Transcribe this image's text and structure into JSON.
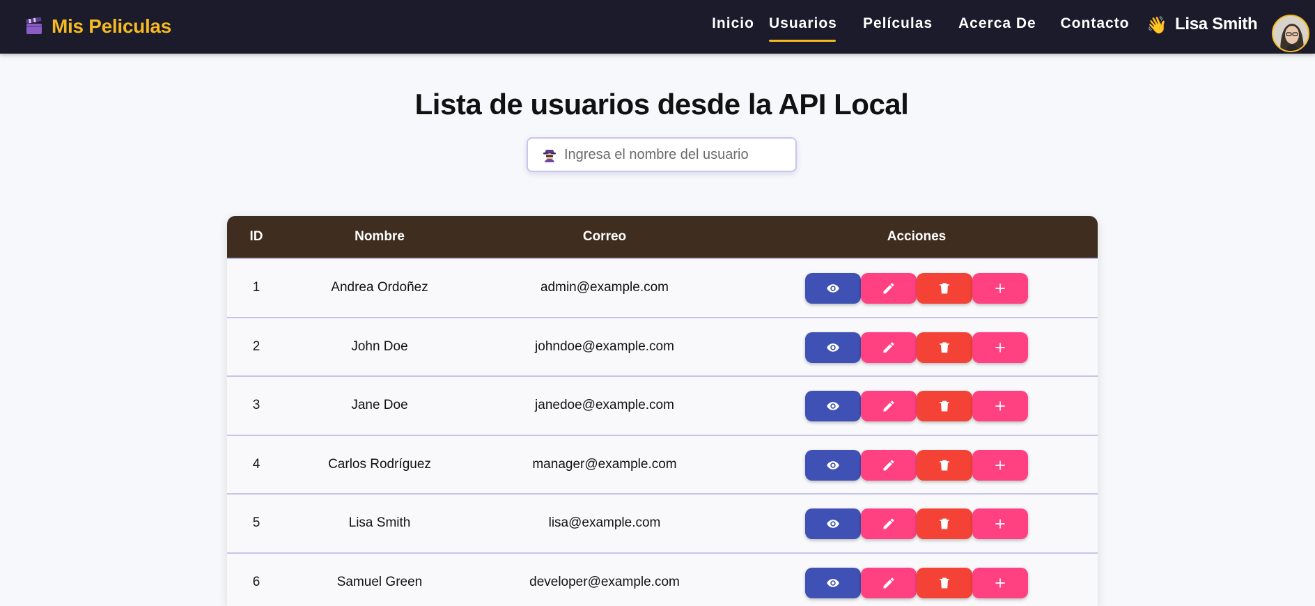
{
  "brand": {
    "title": "Mis Peliculas",
    "color": "#f5b921",
    "icon": "clapperboard-icon"
  },
  "nav": {
    "items": [
      {
        "label": "Inicio"
      },
      {
        "label": "Usuarios",
        "active": true
      },
      {
        "label": "Películas"
      },
      {
        "label": "Acerca De"
      },
      {
        "label": "Contacto"
      }
    ],
    "greeting_icon": "👋",
    "user_name": "Lisa Smith"
  },
  "page": {
    "title": "Lista de usuarios desde la API Local"
  },
  "search": {
    "placeholder": "Ingresa el nombre del usuario",
    "value": "",
    "icon": "detective-icon"
  },
  "table": {
    "headers": {
      "id": "ID",
      "name": "Nombre",
      "email": "Correo",
      "actions": "Acciones"
    },
    "rows": [
      {
        "id": "1",
        "name": "Andrea Ordoñez",
        "email": "admin@example.com"
      },
      {
        "id": "2",
        "name": "John Doe",
        "email": "johndoe@example.com"
      },
      {
        "id": "3",
        "name": "Jane Doe",
        "email": "janedoe@example.com"
      },
      {
        "id": "4",
        "name": "Carlos Rodríguez",
        "email": "manager@example.com"
      },
      {
        "id": "5",
        "name": "Lisa Smith",
        "email": "lisa@example.com"
      },
      {
        "id": "6",
        "name": "Samuel Green",
        "email": "developer@example.com"
      }
    ],
    "action_buttons": [
      {
        "icon": "eye-icon",
        "color": "#3f51b5"
      },
      {
        "icon": "pencil-icon",
        "color": "#ff4081"
      },
      {
        "icon": "trash-icon",
        "color": "#f44336"
      },
      {
        "icon": "plus-icon",
        "color": "#ff4081"
      }
    ]
  },
  "colors": {
    "navbar": "#1c1b2c",
    "table_header": "#3f2e1f",
    "accent": "#f5b921"
  }
}
